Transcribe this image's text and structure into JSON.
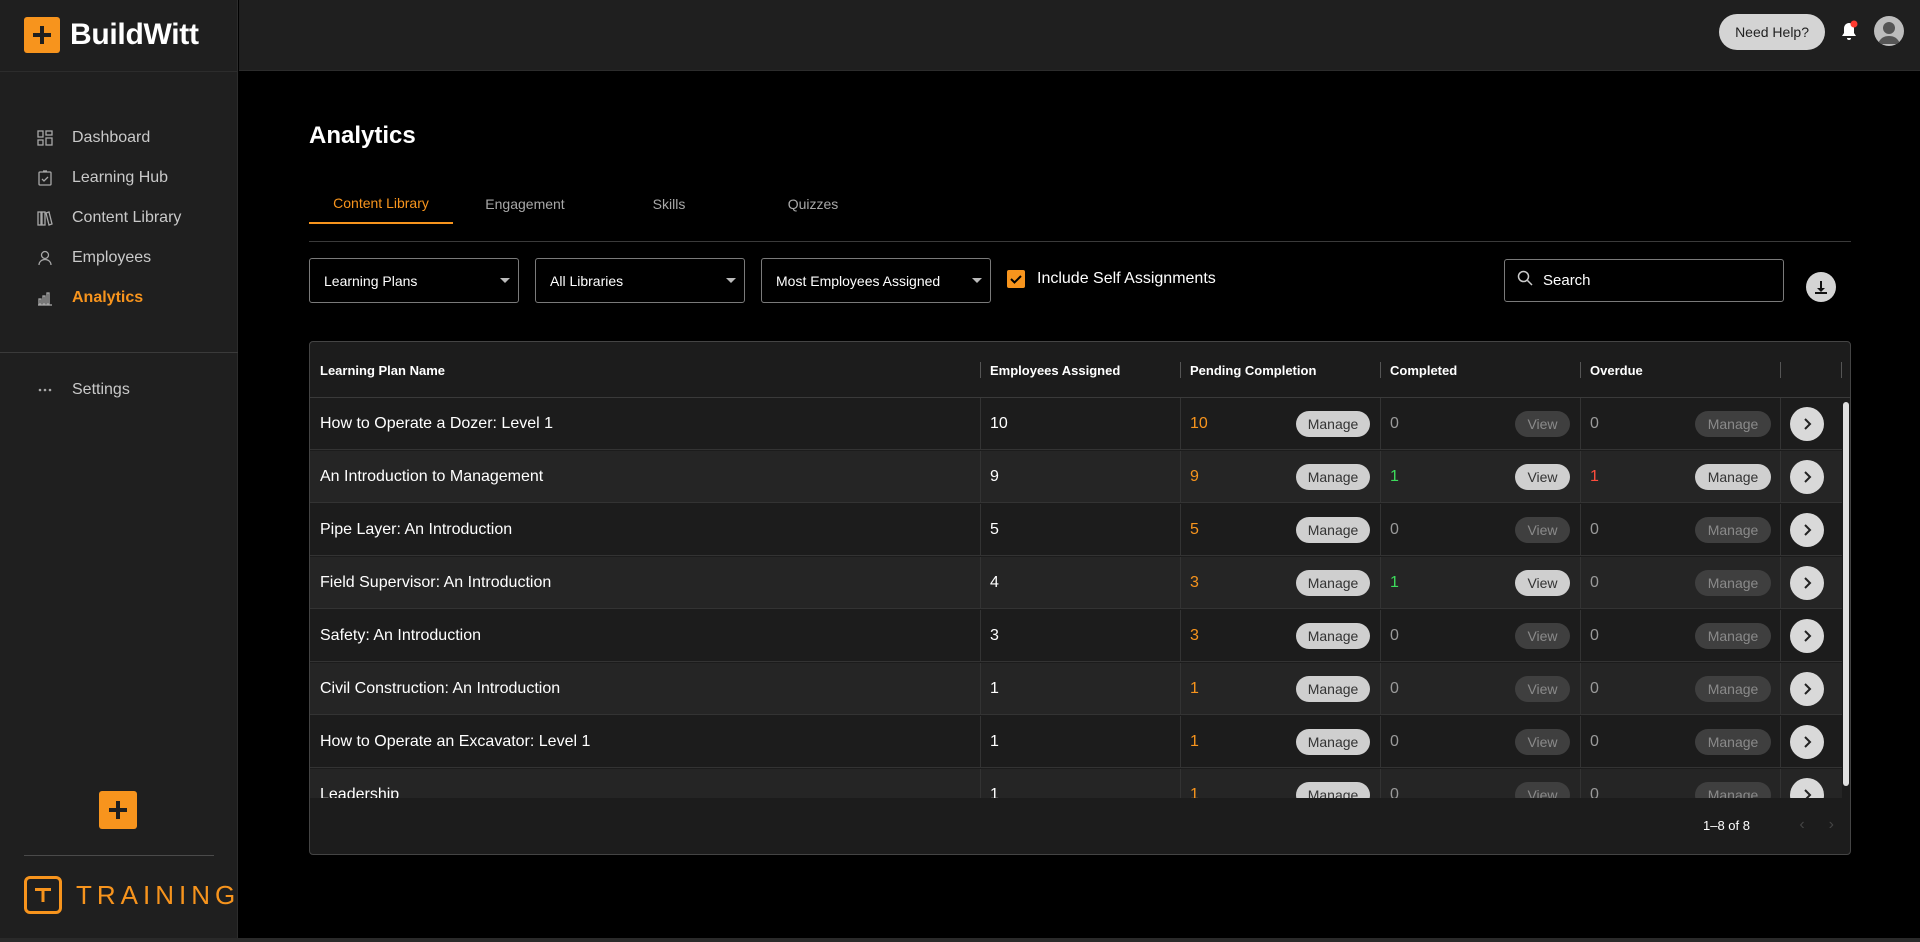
{
  "brand": {
    "name": "BuildWitt",
    "footer_text": "TRAINING"
  },
  "sidebar": {
    "items": [
      {
        "label": "Dashboard",
        "icon": "dashboard-icon",
        "active": false
      },
      {
        "label": "Learning Hub",
        "icon": "clipboard-check-icon",
        "active": false
      },
      {
        "label": "Content Library",
        "icon": "books-icon",
        "active": false
      },
      {
        "label": "Employees",
        "icon": "person-icon",
        "active": false
      },
      {
        "label": "Analytics",
        "icon": "bar-chart-icon",
        "active": true
      }
    ],
    "settings": {
      "label": "Settings",
      "icon": "more-dots-icon"
    }
  },
  "topbar": {
    "help_label": "Need Help?"
  },
  "page": {
    "title": "Analytics"
  },
  "tabs": [
    {
      "label": "Content Library",
      "active": true
    },
    {
      "label": "Engagement",
      "active": false
    },
    {
      "label": "Skills",
      "active": false
    },
    {
      "label": "Quizzes",
      "active": false
    }
  ],
  "filters": {
    "type": "Learning Plans",
    "library": "All Libraries",
    "sort": "Most Employees Assigned",
    "include_self_label": "Include Self Assignments",
    "include_self_checked": true,
    "search_placeholder": "Search"
  },
  "table": {
    "columns": [
      "Learning Plan Name",
      "Employees Assigned",
      "Pending Completion",
      "Completed",
      "Overdue"
    ],
    "button_labels": {
      "manage": "Manage",
      "view": "View"
    },
    "rows": [
      {
        "name": "How to Operate a Dozer: Level 1",
        "assigned": "10",
        "pending": "10",
        "completed": "0",
        "overdue": "0"
      },
      {
        "name": "An Introduction to Management",
        "assigned": "9",
        "pending": "9",
        "completed": "1",
        "overdue": "1"
      },
      {
        "name": "Pipe Layer: An Introduction",
        "assigned": "5",
        "pending": "5",
        "completed": "0",
        "overdue": "0"
      },
      {
        "name": "Field Supervisor: An Introduction",
        "assigned": "4",
        "pending": "3",
        "completed": "1",
        "overdue": "0"
      },
      {
        "name": "Safety: An Introduction",
        "assigned": "3",
        "pending": "3",
        "completed": "0",
        "overdue": "0"
      },
      {
        "name": "Civil Construction: An Introduction",
        "assigned": "1",
        "pending": "1",
        "completed": "0",
        "overdue": "0"
      },
      {
        "name": "How to Operate an Excavator: Level 1",
        "assigned": "1",
        "pending": "1",
        "completed": "0",
        "overdue": "0"
      },
      {
        "name": "Leadership",
        "assigned": "1",
        "pending": "1",
        "completed": "0",
        "overdue": "0"
      }
    ],
    "pagination": "1–8 of 8"
  },
  "colors": {
    "accent": "#f7941d",
    "completed": "#3ddc5c",
    "overdue": "#ff4d3d",
    "sidebar_bg": "#1f1f1f"
  }
}
